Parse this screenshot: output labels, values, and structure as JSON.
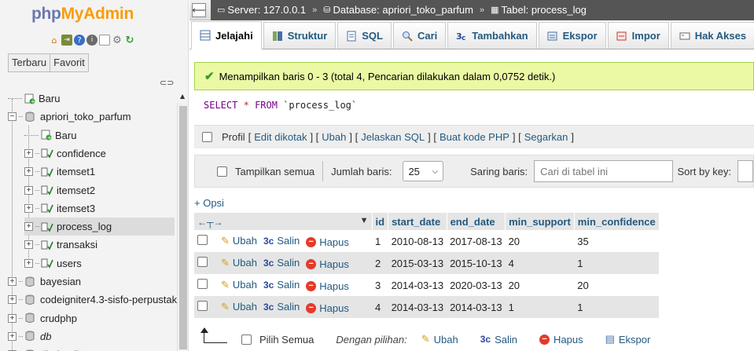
{
  "logo": {
    "part1": "php",
    "part2": "MyAdmin"
  },
  "nav_tabs": [
    "Terbaru",
    "Favorit"
  ],
  "tree": [
    {
      "label": "Baru",
      "level": 0,
      "type": "new",
      "top": 0
    },
    {
      "label": "apriori_toko_parfum",
      "level": 0,
      "type": "db",
      "expander": "−"
    },
    {
      "label": "Baru",
      "level": 1,
      "type": "new"
    },
    {
      "label": "confidence",
      "level": 1,
      "type": "table",
      "expander": "+"
    },
    {
      "label": "itemset1",
      "level": 1,
      "type": "table",
      "expander": "+"
    },
    {
      "label": "itemset2",
      "level": 1,
      "type": "table",
      "expander": "+"
    },
    {
      "label": "itemset3",
      "level": 1,
      "type": "table",
      "expander": "+"
    },
    {
      "label": "process_log",
      "level": 1,
      "type": "table",
      "expander": "+",
      "selected": true
    },
    {
      "label": "transaksi",
      "level": 1,
      "type": "table",
      "expander": "+"
    },
    {
      "label": "users",
      "level": 1,
      "type": "table",
      "expander": "+"
    },
    {
      "label": "bayesian",
      "level": 0,
      "type": "db",
      "expander": "+"
    },
    {
      "label": "codeigniter4.3-sisfo-perpustak",
      "level": 0,
      "type": "db",
      "expander": "+"
    },
    {
      "label": "crudphp",
      "level": 0,
      "type": "db",
      "expander": "+"
    },
    {
      "label": "db",
      "level": 0,
      "type": "db",
      "expander": "+",
      "italic": true
    },
    {
      "label": "dbphpnilo",
      "level": 0,
      "type": "db",
      "expander": "+"
    }
  ],
  "breadcrumb": {
    "server": "Server: 127.0.0.1",
    "database": "Database: apriori_toko_parfum",
    "table": "Tabel: process_log"
  },
  "menu_tabs": [
    "Jelajahi",
    "Struktur",
    "SQL",
    "Cari",
    "Tambahkan",
    "Ekspor",
    "Impor",
    "Hak Akses"
  ],
  "success_message": "Menampilkan baris 0 - 3 (total 4, Pencarian dilakukan dalam 0,0752 detik.)",
  "sql": {
    "keyword1": "SELECT",
    "star": "*",
    "keyword2": "FROM",
    "table": "`process_log`"
  },
  "profile": {
    "label": "Profil",
    "links": [
      "Edit dikotak",
      "Ubah",
      "Jelaskan SQL",
      "Buat kode PHP",
      "Segarkan"
    ]
  },
  "navbar": {
    "show_all": "Tampilkan semua",
    "rows_label": "Jumlah baris:",
    "rows_value": "25",
    "filter_label": "Saring baris:",
    "filter_placeholder": "Cari di tabel ini",
    "sort_label": "Sort by key:"
  },
  "options_link": "+ Opsi",
  "columns": [
    "id",
    "start_date",
    "end_date",
    "min_support",
    "min_confidence"
  ],
  "row_actions": {
    "edit": "Ubah",
    "copy": "Salin",
    "delete": "Hapus"
  },
  "rows": [
    [
      "1",
      "2010-08-13",
      "2017-08-13",
      "20",
      "35"
    ],
    [
      "2",
      "2015-03-13",
      "2015-10-13",
      "4",
      "1"
    ],
    [
      "3",
      "2014-03-13",
      "2020-03-13",
      "20",
      "20"
    ],
    [
      "4",
      "2014-03-13",
      "2014-03-13",
      "1",
      "1"
    ]
  ],
  "bottom": {
    "select_all": "Pilih Semua",
    "with_selected": "Dengan pilihan:",
    "edit": "Ubah",
    "copy": "Salin",
    "delete": "Hapus",
    "export": "Ekspor"
  }
}
